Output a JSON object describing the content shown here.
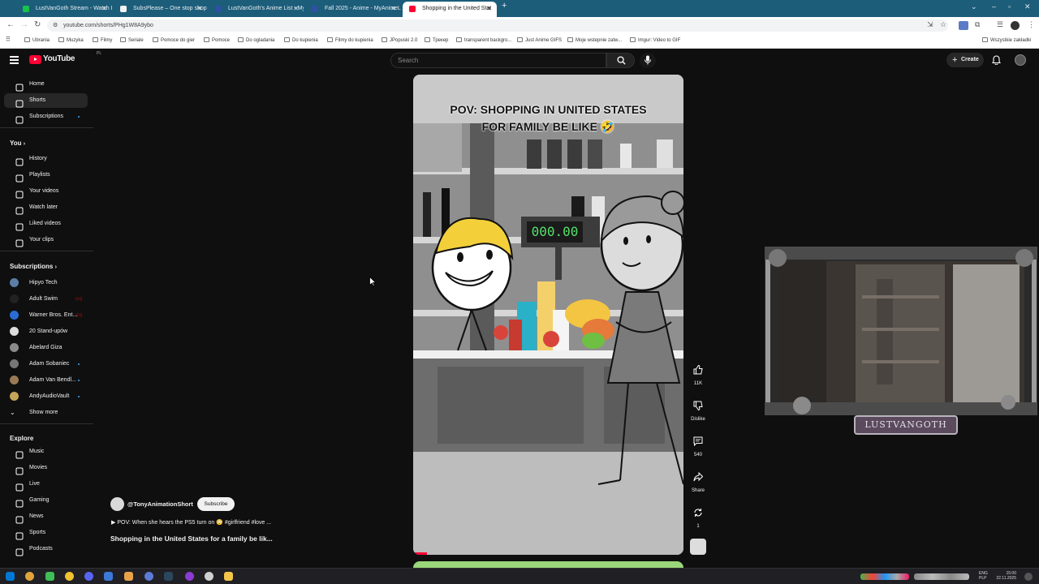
{
  "browser": {
    "tabs": [
      {
        "title": "LustVanGoth Stream - Watch L",
        "color": "#19c24a"
      },
      {
        "title": "SubsPlease – One stop shop fo",
        "color": "#f2f2f2"
      },
      {
        "title": "LustVanGoth's Anime List - My",
        "color": "#2e51a2"
      },
      {
        "title": "Fall 2025 - Anime - MyAnimeLi",
        "color": "#2e51a2"
      },
      {
        "title": "Shopping in the United Stat",
        "color": "#ff0033"
      }
    ],
    "new_tab": "+",
    "url": "youtube.com/shorts/PHg1W8A9ybo",
    "bookmarks": [
      "Ubrania",
      "Muzyka",
      "Filmy",
      "Seriale",
      "Pomoce do gier",
      "Pomoce",
      "Do ogladania",
      "Do kupienia",
      "Filmy do kupienia",
      "JPopuski 2.0",
      "Трекер",
      "transparent backgro...",
      "Just Anime GIFS",
      "Moje wstepnie zatw...",
      "Imgur: Video to GIF"
    ],
    "all_bookmarks": "Wszystkie zakładki"
  },
  "header": {
    "logo": "YouTube",
    "country": "PL",
    "search_placeholder": "Search",
    "create_label": "Create"
  },
  "sidebar": {
    "main": [
      {
        "label": "Home",
        "icon": "home-icon"
      },
      {
        "label": "Shorts",
        "icon": "shorts-icon"
      },
      {
        "label": "Subscriptions",
        "icon": "subscriptions-icon"
      }
    ],
    "you_heading": "You",
    "you": [
      {
        "label": "History",
        "icon": "history-icon"
      },
      {
        "label": "Playlists",
        "icon": "playlists-icon"
      },
      {
        "label": "Your videos",
        "icon": "your-videos-icon"
      },
      {
        "label": "Watch later",
        "icon": "watch-later-icon"
      },
      {
        "label": "Liked videos",
        "icon": "liked-videos-icon"
      },
      {
        "label": "Your clips",
        "icon": "clips-icon"
      }
    ],
    "subs_heading": "Subscriptions",
    "subscriptions": [
      {
        "label": "Hipyo Tech",
        "badge": "",
        "color": "#5c7ea6"
      },
      {
        "label": "Adult Swim",
        "badge": "live",
        "color": "#222222"
      },
      {
        "label": "Warner Bros. Ent...",
        "badge": "live",
        "color": "#2b6bd6"
      },
      {
        "label": "20 Stand-upów",
        "badge": "",
        "color": "#dddddd"
      },
      {
        "label": "Abelard Giza",
        "badge": "",
        "color": "#8a8a8a"
      },
      {
        "label": "Adam Sobaniec",
        "badge": "dot",
        "color": "#777777"
      },
      {
        "label": "Adam Van Bendl...",
        "badge": "dot",
        "color": "#9a7a55"
      },
      {
        "label": "AndyAudioVault",
        "badge": "dot",
        "color": "#c4a35a"
      }
    ],
    "show_more": "Show more",
    "explore_heading": "Explore",
    "explore": [
      {
        "label": "Music",
        "icon": "music-icon"
      },
      {
        "label": "Movies",
        "icon": "movies-icon"
      },
      {
        "label": "Live",
        "icon": "live-icon"
      },
      {
        "label": "Gaming",
        "icon": "gaming-icon"
      },
      {
        "label": "News",
        "icon": "news-icon"
      },
      {
        "label": "Sports",
        "icon": "sports-icon"
      },
      {
        "label": "Podcasts",
        "icon": "podcasts-icon"
      }
    ]
  },
  "short": {
    "overlay_title_line1": "POV: SHOPPING IN UNITED STATES",
    "overlay_title_line2": "FOR FAMILY BE LIKE 🤣",
    "price_display": "000.00",
    "channel": "@TonyAnimationShort",
    "subscribe_label": "Subscribe",
    "suggestion": "▶  POV: When she hears the PS5 turn on 😳 #girlfriend #love ...",
    "title": "Shopping in the United States for a family be lik...",
    "progress_fraction": 0.05
  },
  "actions": {
    "likes": "11K",
    "dislike": "Dislike",
    "comments": "540",
    "share": "Share",
    "remix": "1"
  },
  "stream_overlay": {
    "name": "LUSTVANGOTH"
  },
  "taskbar": {
    "lang": "ENG",
    "lang2": "PLP",
    "time": "15:00",
    "date": "22.11.2025"
  }
}
